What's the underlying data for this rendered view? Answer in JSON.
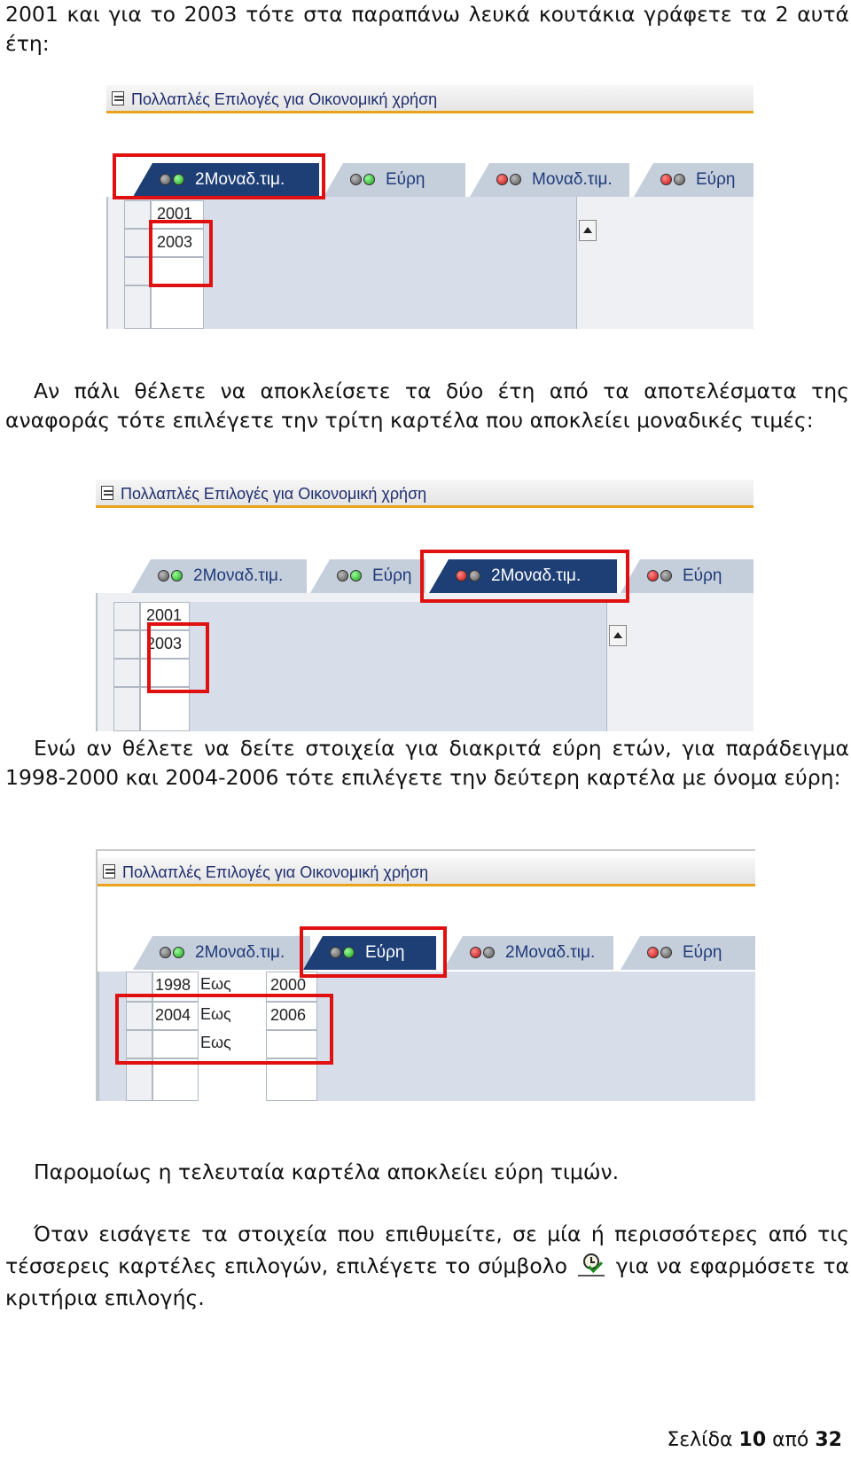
{
  "intro": {
    "text": "2001 και για το 2003 τότε στα παραπάνω λευκά κουτάκια γράφετε τα 2 αυτά έτη:"
  },
  "sap_title": "Πολλαπλές Επιλογές για Οικονομική χρήση",
  "screenshot1": {
    "tabs": [
      {
        "label": "2Μοναδ.τιμ.",
        "dots": [
          "grey",
          "green"
        ],
        "active": true
      },
      {
        "label": "Εύρη",
        "dots": [
          "grey",
          "green"
        ],
        "active": false
      },
      {
        "label": "Μοναδ.τιμ.",
        "dots": [
          "red",
          "grey"
        ],
        "active": false
      },
      {
        "label": "Εύρη",
        "dots": [
          "red",
          "grey"
        ],
        "active": false
      }
    ],
    "values": [
      "2001",
      "2003"
    ]
  },
  "para2": {
    "text": "Αν πάλι θέλετε να αποκλείσετε τα δύο έτη από τα αποτελέσματα της αναφοράς τότε επιλέγετε την τρίτη καρτέλα που αποκλείει μοναδικές τιμές:"
  },
  "screenshot2": {
    "tabs": [
      {
        "label": "2Μοναδ.τιμ.",
        "dots": [
          "grey",
          "green"
        ],
        "active": false
      },
      {
        "label": "Εύρη",
        "dots": [
          "grey",
          "green"
        ],
        "active": false
      },
      {
        "label": "2Μοναδ.τιμ.",
        "dots": [
          "red",
          "grey"
        ],
        "active": true
      },
      {
        "label": "Εύρη",
        "dots": [
          "red",
          "grey"
        ],
        "active": false
      }
    ],
    "values": [
      "2001",
      "2003"
    ]
  },
  "para3": {
    "text": "Ενώ αν θέλετε να δείτε στοιχεία για διακριτά εύρη ετών, για παράδειγμα 1998-2000 και 2004-2006 τότε επιλέγετε την δεύτερη καρτέλα με όνομα εύρη:"
  },
  "screenshot3": {
    "tabs": [
      {
        "label": "2Μοναδ.τιμ.",
        "dots": [
          "grey",
          "green"
        ],
        "active": false
      },
      {
        "label": "Εύρη",
        "dots": [
          "grey",
          "green"
        ],
        "active": true
      },
      {
        "label": "2Μοναδ.τιμ.",
        "dots": [
          "red",
          "grey"
        ],
        "active": false
      },
      {
        "label": "Εύρη",
        "dots": [
          "red",
          "grey"
        ],
        "active": false
      }
    ],
    "to_label": "Εως",
    "rows": [
      {
        "from": "1998",
        "to": "2000"
      },
      {
        "from": "2004",
        "to": "2006"
      },
      {
        "from": "",
        "to": ""
      }
    ]
  },
  "para4": {
    "text": "Παρομοίως η τελευταία καρτέλα αποκλείει εύρη τιμών."
  },
  "para5": {
    "before": "Όταν εισάγετε τα στοιχεία που επιθυμείτε, σε μία ή περισσότερες από τις τέσσερεις καρτέλες επιλογών, επιλέγετε το σύμβολο",
    "after": "για να εφαρμόσετε τα κριτήρια επιλογής.",
    "icon": "execute-clock-check-icon"
  },
  "footer": {
    "prefix": "Σελίδα",
    "page": "10",
    "middle": "από",
    "total": "32"
  }
}
